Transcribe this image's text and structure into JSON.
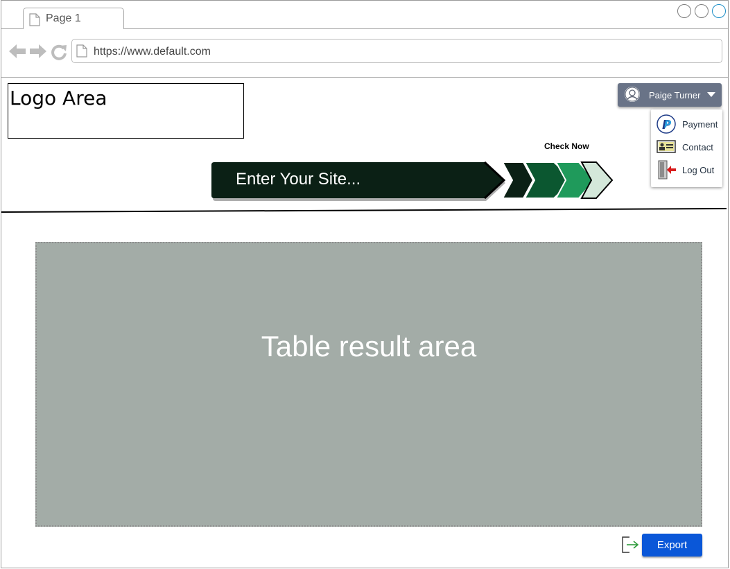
{
  "browser": {
    "tab_label": "Page 1",
    "url": "https://www.default.com"
  },
  "header": {
    "logo_text": "Logo Area",
    "user_name": "Paige Turner",
    "user_menu": {
      "items": [
        {
          "label": "Payment",
          "icon": "paypal-icon"
        },
        {
          "label": "Contact",
          "icon": "contact-card-icon"
        },
        {
          "label": "Log Out",
          "icon": "logout-door-icon"
        }
      ]
    }
  },
  "search": {
    "check_label": "Check Now",
    "site_text": "Enter Your Site..."
  },
  "main": {
    "table_text": "Table result area"
  },
  "footer": {
    "export_label": "Export",
    "export_icon": "export-icon"
  },
  "colors": {
    "dark_bar": "#0b2015",
    "chevron_1": "#0b5730",
    "chevron_2": "#1f9a5b",
    "chevron_3": "#d4e8da",
    "table_bg": "#a3aca7",
    "export_bg": "#0a57d8",
    "user_btn_bg": "#697387"
  }
}
